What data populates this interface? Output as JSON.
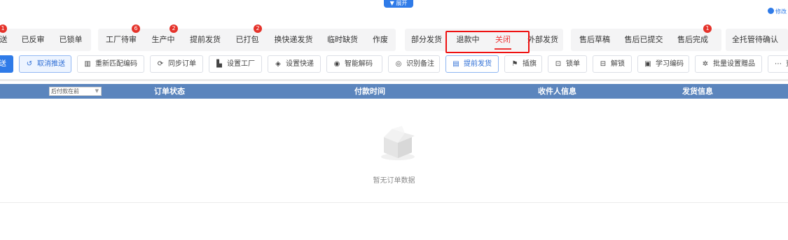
{
  "top": {
    "expand_label": "▼ 展开",
    "edit_label": "修改"
  },
  "tabs": [
    {
      "label": "送",
      "badge": "1"
    },
    {
      "label": "已反审",
      "badge": ""
    },
    {
      "label": "已锁单",
      "badge": ""
    },
    {
      "label": "工厂待审",
      "badge": "6"
    },
    {
      "label": "生产中",
      "badge": "2"
    },
    {
      "label": "提前发货",
      "badge": ""
    },
    {
      "label": "已打包",
      "badge": "2"
    },
    {
      "label": "换快递发货",
      "badge": ""
    },
    {
      "label": "临时缺货",
      "badge": ""
    },
    {
      "label": "作废",
      "badge": ""
    },
    {
      "label": "部分发货",
      "badge": ""
    },
    {
      "label": "退款中",
      "badge": ""
    },
    {
      "label": "关闭",
      "badge": ""
    },
    {
      "label": "外部发货",
      "badge": ""
    },
    {
      "label": "售后草稿",
      "badge": ""
    },
    {
      "label": "售后已提交",
      "badge": ""
    },
    {
      "label": "售后完成",
      "badge": "1"
    },
    {
      "label": "全托管待确认",
      "badge": ""
    }
  ],
  "toolbar": [
    {
      "label": "送",
      "icon": ""
    },
    {
      "label": "取消推送",
      "icon": "undo-icon"
    },
    {
      "label": "重新匹配编码",
      "icon": "barcode-icon"
    },
    {
      "label": "同步订单",
      "icon": "sync-icon"
    },
    {
      "label": "设置工厂",
      "icon": "factory-icon"
    },
    {
      "label": "设置快递",
      "icon": "package-icon"
    },
    {
      "label": "智能解码",
      "icon": "eye-icon"
    },
    {
      "label": "识别备注",
      "icon": "scan-icon"
    },
    {
      "label": "提前发货",
      "icon": "document-icon"
    },
    {
      "label": "插旗",
      "icon": "flag-icon"
    },
    {
      "label": "锁单",
      "icon": "lock-icon"
    },
    {
      "label": "解锁",
      "icon": "unlock-icon"
    },
    {
      "label": "学习编码",
      "icon": "image-icon"
    },
    {
      "label": "批量设置赠品",
      "icon": "gear-icon"
    },
    {
      "label": "更",
      "icon": "more-icon"
    }
  ],
  "table": {
    "sort_select": "后付款在前",
    "headers": [
      "订单状态",
      "付款时间",
      "收件人信息",
      "发货信息"
    ]
  },
  "empty": {
    "text": "暂无订单数据"
  }
}
